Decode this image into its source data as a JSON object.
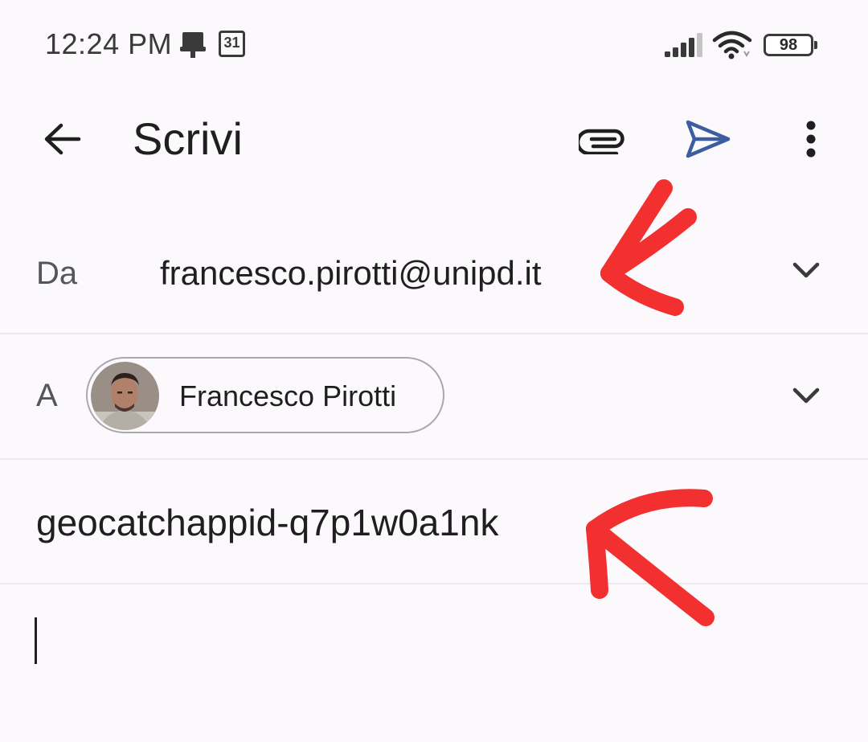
{
  "status_bar": {
    "time": "12:24 PM",
    "calendar_day": "31",
    "battery_level": "98",
    "icons": [
      "download-icon",
      "calendar-icon",
      "signal-icon",
      "wifi-icon",
      "battery-icon"
    ]
  },
  "app_bar": {
    "title": "Scrivi",
    "icons": [
      "back-arrow-icon",
      "attach-icon",
      "send-icon",
      "more-vert-icon"
    ]
  },
  "from": {
    "label": "Da",
    "value": "francesco.pirotti@unipd.it"
  },
  "to": {
    "label": "A",
    "recipient_name": "Francesco Pirotti"
  },
  "subject": {
    "value": "geocatchappid-q7p1w0a1nk"
  },
  "body": {
    "value": ""
  },
  "colors": {
    "background": "#fcf9fd",
    "send_icon": "#3c5ea0",
    "annotation": "#f2302f",
    "divider": "#ece8ee"
  }
}
